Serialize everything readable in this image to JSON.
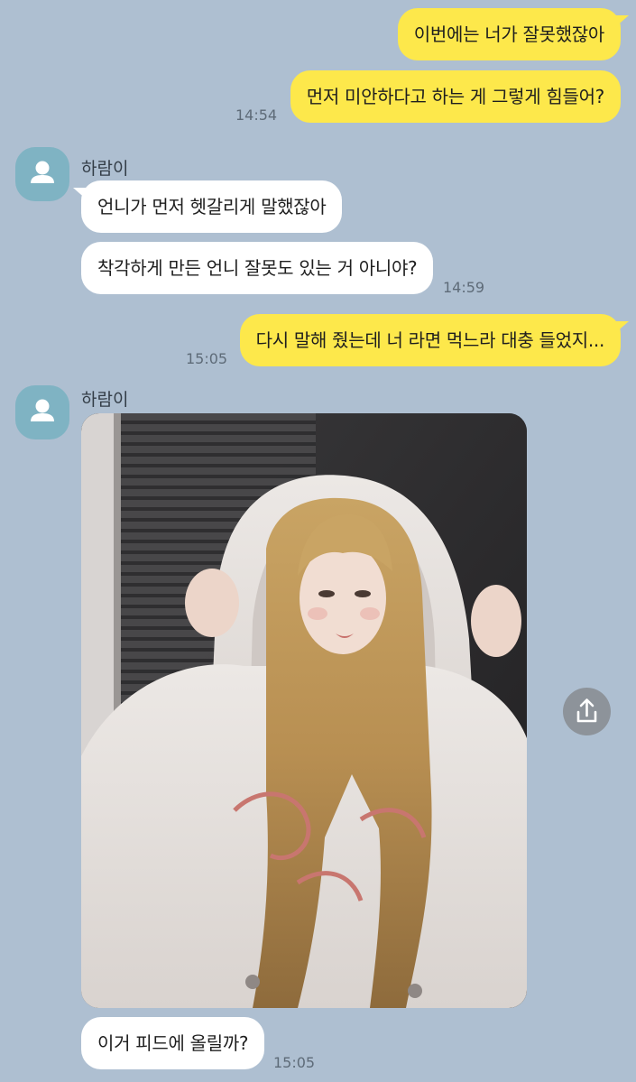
{
  "messages": [
    {
      "text": "이번에는 너가 잘못했잖아"
    },
    {
      "text": "먼저 미안하다고 하는 게 그렇게 힘들어?",
      "time": "14:54"
    },
    {
      "text": "언니가 먼저 헷갈리게 말했잖아"
    },
    {
      "text": "착각하게 만든 언니 잘못도 있는 거 아니야?",
      "time": "14:59"
    },
    {
      "text": "다시 말해 줬는데 너 라면 먹느라 대충 들었지...",
      "time": "15:05"
    },
    {
      "text": "이거 피드에 올릴까?",
      "time": "15:05"
    }
  ],
  "senders": [
    {
      "name": "하람이",
      "avatar_icon": "person-icon"
    },
    {
      "name": "하람이",
      "avatar_icon": "person-icon"
    }
  ],
  "photo": {
    "description_icon": "photo-image"
  },
  "share": {
    "icon": "share-icon"
  },
  "colors": {
    "background": "#aebfd1",
    "my_bubble": "#fde84b",
    "their_bubble": "#ffffff",
    "avatar": "#7fb3c3"
  }
}
